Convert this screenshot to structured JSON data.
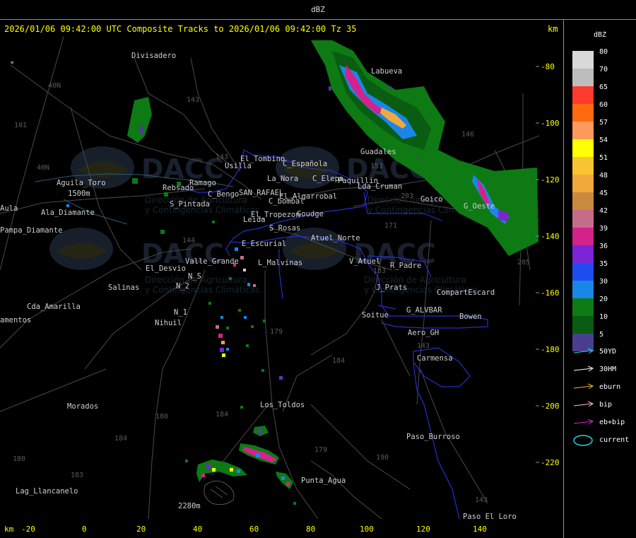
{
  "window_title": "dBZ",
  "header_text": "2026/01/06 09:42:00 UTC Composite Tracks to 2026/01/06 09:42:00 Tz 35",
  "unit_label": "km",
  "x_ticks": [
    "-20",
    "0",
    "20",
    "40",
    "60",
    "80",
    "100",
    "120",
    "140"
  ],
  "y_ticks": [
    "-80",
    "-100",
    "-120",
    "-140",
    "-160",
    "-180",
    "-200",
    "-220"
  ],
  "legend": {
    "title": "dBZ",
    "levels": [
      {
        "label": "80",
        "color": "#d9d9d9"
      },
      {
        "label": "70",
        "color": "#bdbdbd"
      },
      {
        "label": "65",
        "color": "#ff3b2e"
      },
      {
        "label": "60",
        "color": "#ff6a10"
      },
      {
        "label": "57",
        "color": "#ff9a5c"
      },
      {
        "label": "54",
        "color": "#ffff00"
      },
      {
        "label": "51",
        "color": "#f7c531"
      },
      {
        "label": "48",
        "color": "#f0a93a"
      },
      {
        "label": "45",
        "color": "#c98a3d"
      },
      {
        "label": "42",
        "color": "#c46d8b"
      },
      {
        "label": "39",
        "color": "#d4228c"
      },
      {
        "label": "36",
        "color": "#7a24d6"
      },
      {
        "label": "35",
        "color": "#1e4cf0"
      },
      {
        "label": "30",
        "color": "#1a86e8"
      },
      {
        "label": "20",
        "color": "#0d7a13"
      },
      {
        "label": "10",
        "color": "#0a5c12"
      },
      {
        "label": "5",
        "color": "#4a3f8f"
      }
    ],
    "tracks": [
      {
        "label": "50YD",
        "color": "#22d3e6"
      },
      {
        "label": "30HM",
        "color": "#ffffff"
      },
      {
        "label": "eburn",
        "color": "#f0b040"
      },
      {
        "label": "bip",
        "color": "#ffc0c8"
      },
      {
        "label": "eb+bip",
        "color": "#e020e0"
      },
      {
        "label": "current",
        "color": "#22d3e6"
      }
    ]
  },
  "places": [
    "Divisadero",
    "Labueva",
    "Guadales",
    "El_Tombino",
    "Usilla",
    "C_Española",
    "C_Elepa",
    "Aguila_Toro",
    "Rebsado",
    "Ramago",
    "S_Pintada",
    "C_Bengo",
    "SAN_RAFAEL",
    "El_Algarrobal",
    "Paquillin",
    "Goico",
    "Lda_Cruman",
    "C_bombal",
    "El_Tropezon",
    "Goudge",
    "Leida",
    "S_Rosas",
    "Atuel_Norte",
    "E_Escurial",
    "Valle_Grande",
    "L_Malvinas",
    "V_Atuel",
    "R_Padre",
    "El_Desvio",
    "N_S",
    "N_2",
    "Salinas",
    "J_Prats",
    "CompartEscard",
    "G_ALVBAR",
    "Bowen",
    "Soitue",
    "N_1",
    "Nihuil",
    "Cda_Amarilla",
    "Aero_GH",
    "Carmensa",
    "Los_Toldos",
    "Morados",
    "Paso_Burroso",
    "Punta_Agua",
    "Lag_Llancanelo",
    "Paso_El_Loro",
    "Pampa_Diamante",
    "Ala_Diamante",
    "Aula",
    "amentos",
    "La_Nora",
    "G_Oeste"
  ],
  "routes": [
    "40N",
    "101",
    "143",
    "143",
    "153",
    "203",
    "146",
    "171",
    "183",
    "144",
    "179",
    "184",
    "180",
    "184",
    "179",
    "190",
    "143",
    "183",
    "184",
    "143",
    "205",
    "40N",
    "180"
  ],
  "watermark": {
    "brand": "DACC",
    "line1": "Dirección de Agricultura",
    "line2": "y Contingencias Climáticas"
  },
  "map_labels": {
    "lake_elev": "1500m",
    "lake_elev_2": "2280m",
    "marker": "*"
  }
}
